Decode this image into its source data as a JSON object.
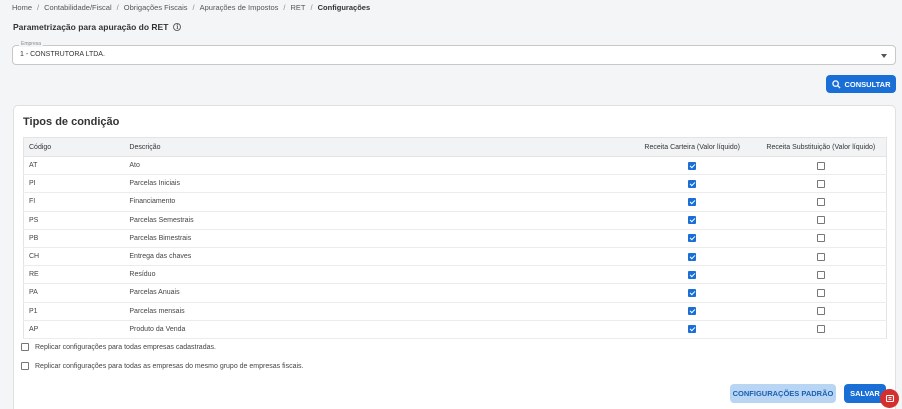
{
  "breadcrumb": [
    "Home",
    "Contabilidade/Fiscal",
    "Obrigações Fiscais",
    "Apurações de Impostos",
    "RET",
    "Configurações"
  ],
  "page_title": "Parametrização para apuração do RET",
  "empresa": {
    "label": "Empresa",
    "value": "1 - CONSTRUTORA LTDA."
  },
  "consultar_label": "CONSULTAR",
  "panel_title": "Tipos de condição",
  "table": {
    "headers": {
      "codigo": "Código",
      "descricao": "Descrição",
      "carteira": "Receita Carteira (Valor líquido)",
      "substituicao": "Receita Substituição (Valor líquido)"
    },
    "rows": [
      {
        "codigo": "AT",
        "descricao": "Ato",
        "carteira": true,
        "substituicao": false
      },
      {
        "codigo": "PI",
        "descricao": "Parcelas Iniciais",
        "carteira": true,
        "substituicao": false
      },
      {
        "codigo": "FI",
        "descricao": "Financiamento",
        "carteira": true,
        "substituicao": false
      },
      {
        "codigo": "PS",
        "descricao": "Parcelas Semestrais",
        "carteira": true,
        "substituicao": false
      },
      {
        "codigo": "PB",
        "descricao": "Parcelas Bimestrais",
        "carteira": true,
        "substituicao": false
      },
      {
        "codigo": "CH",
        "descricao": "Entrega das chaves",
        "carteira": true,
        "substituicao": false
      },
      {
        "codigo": "RE",
        "descricao": "Resíduo",
        "carteira": true,
        "substituicao": false
      },
      {
        "codigo": "PA",
        "descricao": "Parcelas Anuais",
        "carteira": true,
        "substituicao": false
      },
      {
        "codigo": "P1",
        "descricao": "Parcelas mensais",
        "carteira": true,
        "substituicao": false
      },
      {
        "codigo": "AP",
        "descricao": "Produto da Venda",
        "carteira": true,
        "substituicao": false
      }
    ]
  },
  "options": {
    "replicar_todas": "Replicar configurações para todas empresas cadastradas.",
    "replicar_grupo": "Replicar configurações para todas as empresas do mesmo grupo de empresas fiscais."
  },
  "buttons": {
    "padrao": "CONFIGURAÇÕES PADRÃO",
    "salvar": "SALVAR"
  },
  "colors": {
    "primary": "#1a6fd6",
    "secondary_bg": "#b9d5f4",
    "fab": "#d32f2f"
  }
}
